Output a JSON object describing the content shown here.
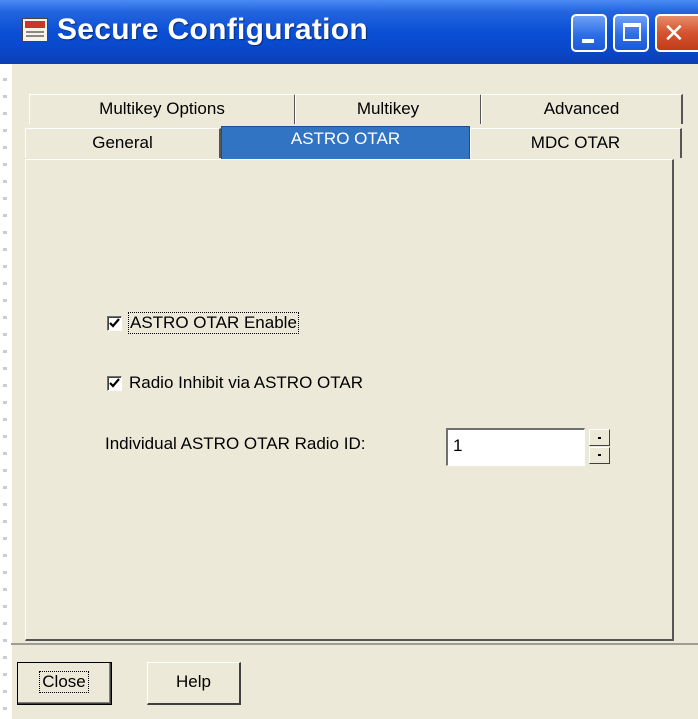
{
  "window": {
    "title": "Secure Configuration"
  },
  "titlebar": {
    "icon": "doc-icon",
    "minimize": "minimize-icon",
    "maximize": "maximize-icon",
    "close": "close-icon",
    "close_glyph": "✕"
  },
  "tabs": {
    "back_row": [
      "Multikey Options",
      "Multikey",
      "Advanced"
    ],
    "front_row": [
      "General",
      "ASTRO OTAR",
      "MDC OTAR"
    ],
    "active": "ASTRO OTAR"
  },
  "astro_otar": {
    "enable_label": "ASTRO OTAR Enable",
    "enable_checked": true,
    "inhibit_label": "Radio Inhibit via ASTRO OTAR",
    "inhibit_checked": true,
    "radio_id_label": "Individual ASTRO OTAR Radio ID:",
    "radio_id_value": "1"
  },
  "buttons": {
    "close_label": "Close",
    "help_label": "Help"
  },
  "colors": {
    "titlebar": "#0a4fd6",
    "active_tab": "#3074c3",
    "window_bg": "#ece9d8",
    "close_button": "#d6532f"
  }
}
